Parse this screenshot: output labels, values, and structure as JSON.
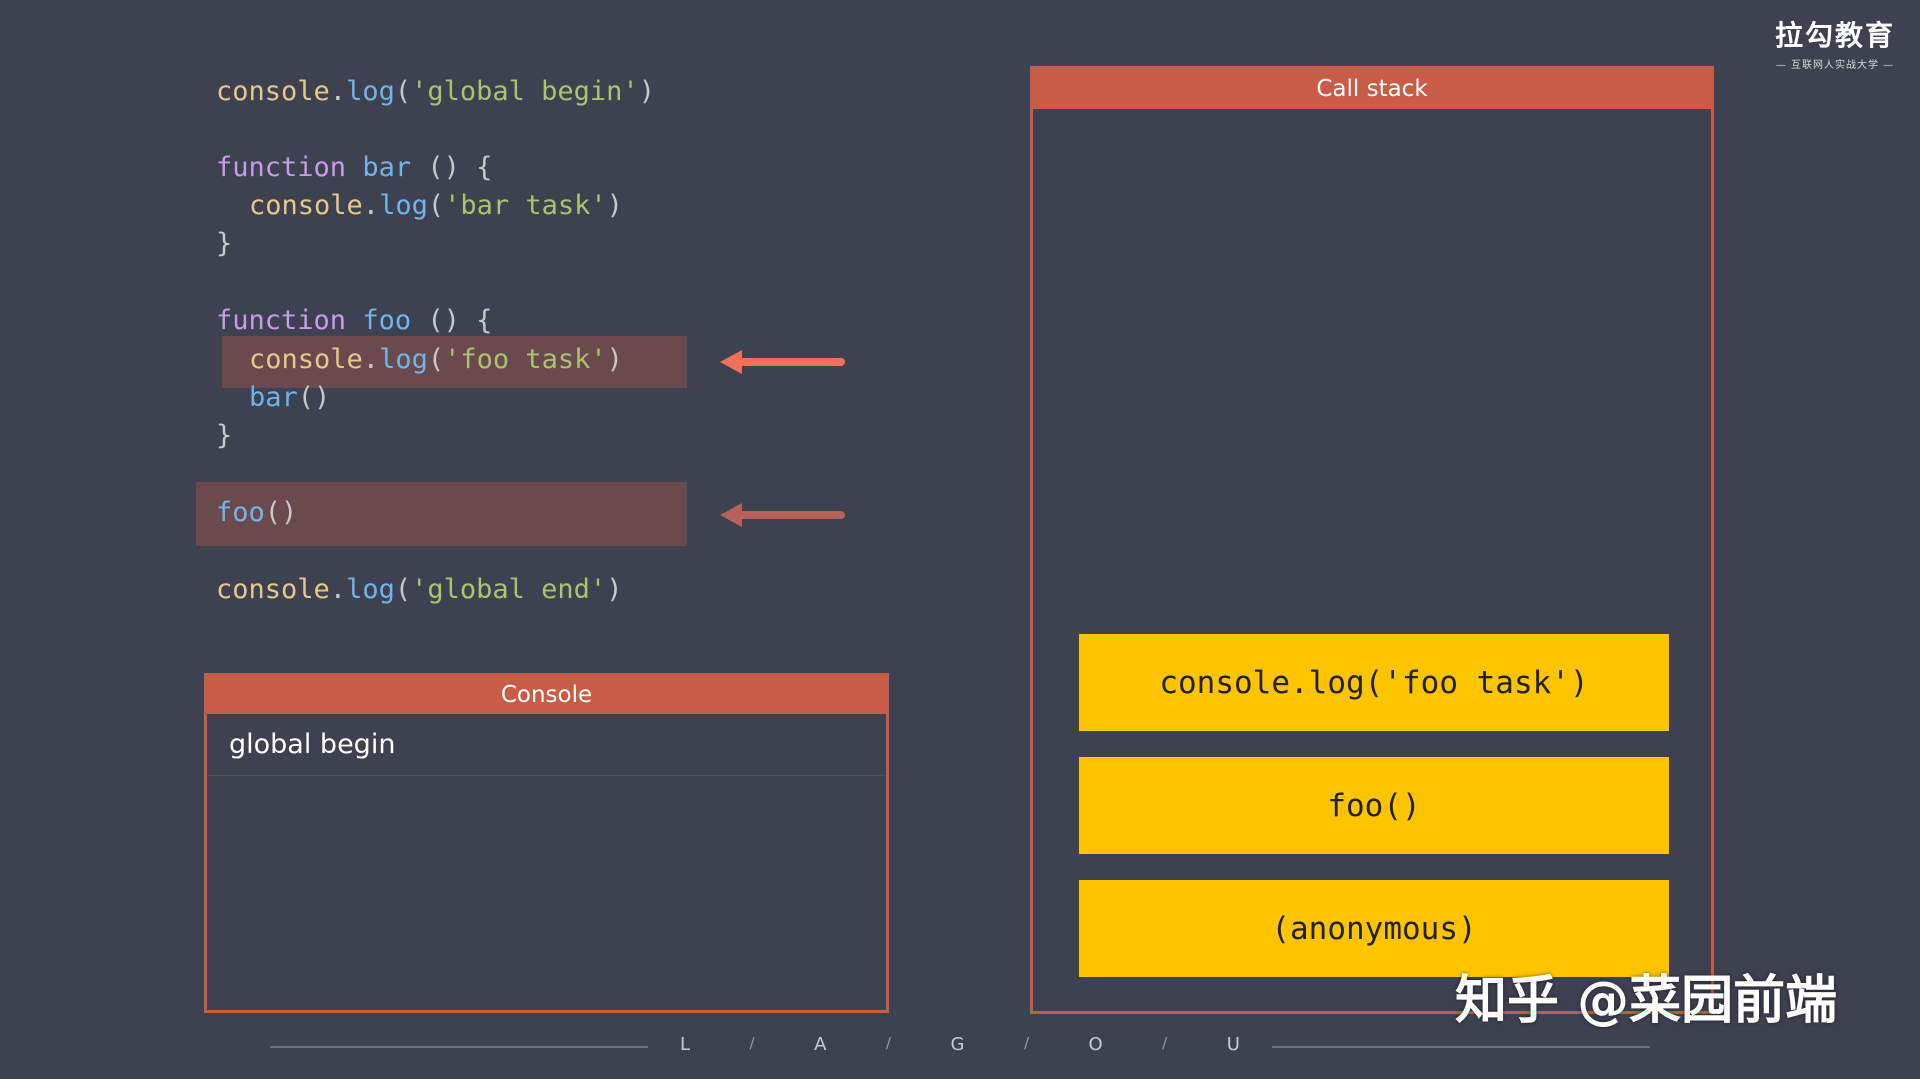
{
  "code": {
    "l1": {
      "obj": "console",
      "dot": ".",
      "method": "log",
      "open": "(",
      "str": "'global begin'",
      "close": ")"
    },
    "l2": {
      "kw": "function",
      "name": "bar",
      "rest": " () {"
    },
    "l3": {
      "obj": "console",
      "dot": ".",
      "method": "log",
      "open": "(",
      "str": "'bar task'",
      "close": ")"
    },
    "l4": "}",
    "l5": {
      "kw": "function",
      "name": "foo",
      "rest": " () {"
    },
    "l6": {
      "obj": "console",
      "dot": ".",
      "method": "log",
      "open": "(",
      "str": "'foo task'",
      "close": ")"
    },
    "l7": {
      "name": "bar",
      "rest": "()"
    },
    "l8": "}",
    "l9": {
      "name": "foo",
      "rest": "()"
    },
    "l10": {
      "obj": "console",
      "dot": ".",
      "method": "log",
      "open": "(",
      "str": "'global end'",
      "close": ")"
    }
  },
  "console_panel": {
    "title": "Console",
    "lines": [
      "global begin"
    ]
  },
  "call_stack": {
    "title": "Call stack",
    "frames": [
      "console.log('foo task')",
      "foo()",
      "(anonymous)"
    ]
  },
  "logo": {
    "main": "拉勾教育",
    "sub": "— 互联网人实战大学 —"
  },
  "watermark": "知乎 @菜园前端",
  "footer": {
    "letters": [
      "L",
      "/",
      "A",
      "/",
      "G",
      "/",
      "O",
      "/",
      "U"
    ]
  },
  "colors": {
    "background": "#3e4150",
    "panel_accent": "#c95c46",
    "stack_frame": "#ffc400",
    "highlight": "#6b4a4e",
    "active_arrow": "#f0705a",
    "dim_arrow": "#b5625a"
  }
}
